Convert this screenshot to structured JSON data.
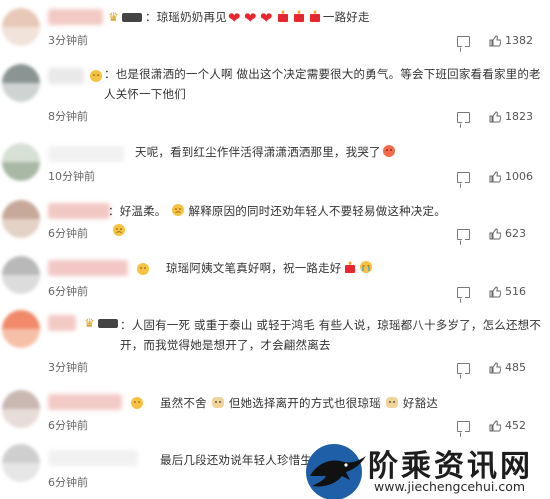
{
  "comments": [
    {
      "text": "：琼瑶奶奶再见",
      "emojis": [
        "heart",
        "heart",
        "heart",
        "candle",
        "candle",
        "candle"
      ],
      "tail": "一路好走",
      "time": "3分钟前",
      "likes": "1382",
      "vip": true
    },
    {
      "text": "：也是很潇洒的一个人啊 做出这个决定需要很大的勇气。等会下班回家看看家里的老人关怀一下他们",
      "time": "8分钟前",
      "likes": "1823"
    },
    {
      "text": "天呢，看到红尘作伴活得潇潇洒洒那里，我哭了",
      "time": "10分钟前",
      "likes": "1006"
    },
    {
      "text": "：好温柔。",
      "mid": "解释原因的同时还劝年轻人不要轻易做这种决定。",
      "time": "6分钟前",
      "likes": "623"
    },
    {
      "text": "琼瑶阿姨文笔真好啊，祝一路走好",
      "time": "6分钟前",
      "likes": "516"
    },
    {
      "text": "：人固有一死 或重于泰山 或轻于鸿毛 有些人说，琼瑶都八十多岁了，怎么还想不开，而我觉得她是想开了，才会翩然离去",
      "time": "3分钟前",
      "likes": "485",
      "vip": true
    },
    {
      "text": "虽然不舍",
      "mid": "但她选择离开的方式也很琼瑶",
      "tail": "好豁达",
      "time": "6分钟前",
      "likes": "452"
    },
    {
      "text": "最后几段还劝说年轻人珍惜生",
      "time": "6分钟前",
      "likes": ""
    }
  ],
  "colors": {
    "heart": "#e8262d",
    "candle": "#e8262d",
    "emoji_face": "#f5c242"
  },
  "watermark": {
    "title": "阶乘资讯网",
    "url": "www.jiechengcehui.com"
  },
  "icons": [
    "reply-icon",
    "like-icon",
    "crown-icon",
    "raven-icon"
  ]
}
